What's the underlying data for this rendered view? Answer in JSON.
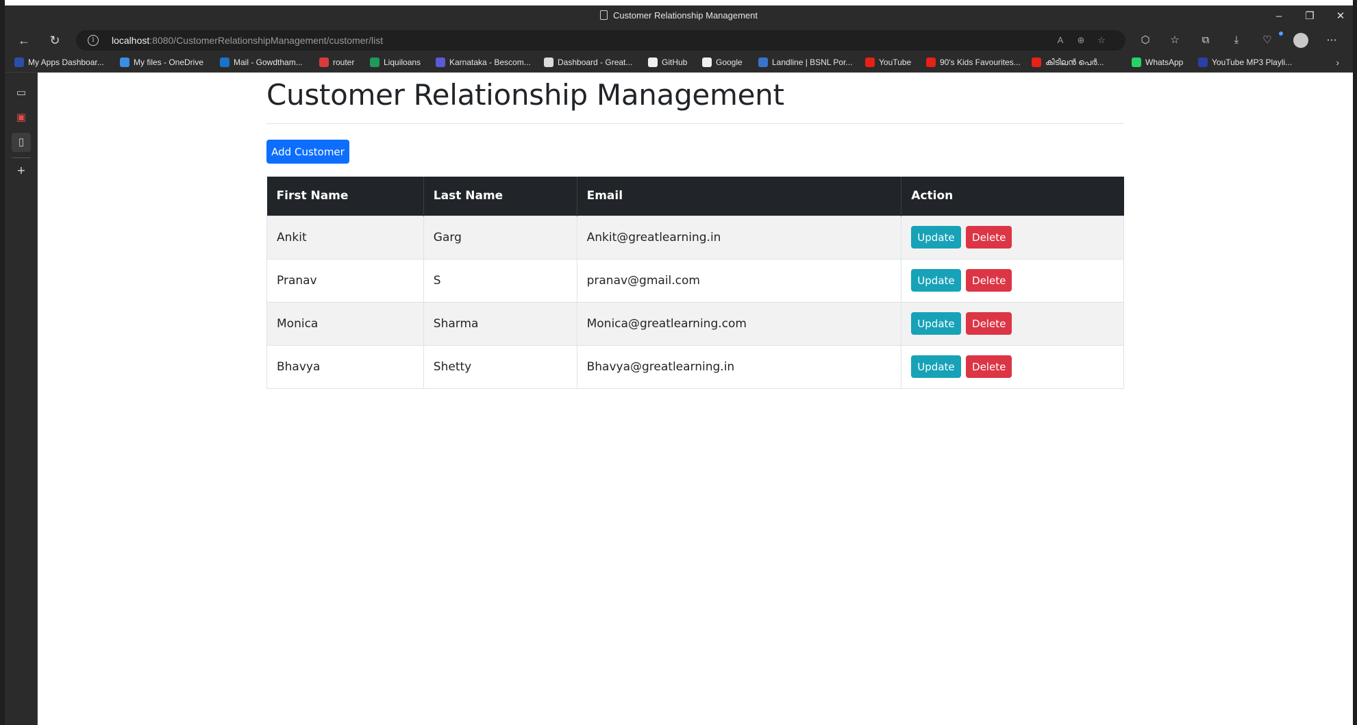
{
  "window": {
    "title": "Customer Relationship Management",
    "minimize": "–",
    "restore": "❐",
    "close": "✕"
  },
  "toolbar": {
    "back": "←",
    "refresh": "↻",
    "url_host": "localhost",
    "url_rest": ":8080/CustomerRelationshipManagement/customer/list",
    "more": "⋯"
  },
  "bookmarks": [
    {
      "label": "My Apps Dashboar...",
      "color": "#2b4ea8"
    },
    {
      "label": "My files - OneDrive",
      "color": "#3a8ee6"
    },
    {
      "label": "Mail - Gowdtham...",
      "color": "#1a73c8"
    },
    {
      "label": "router",
      "color": "#d93b3b"
    },
    {
      "label": "Liquiloans",
      "color": "#1e9a5a"
    },
    {
      "label": "Karnataka - Bescom...",
      "color": "#5a5ad6"
    },
    {
      "label": "Dashboard - Great...",
      "color": "#dcdcdc"
    },
    {
      "label": "GitHub",
      "color": "#f0f0f0"
    },
    {
      "label": "Google",
      "color": "#f0f0f0"
    },
    {
      "label": "Landline | BSNL Por...",
      "color": "#3a74c9"
    },
    {
      "label": "YouTube",
      "color": "#e62117"
    },
    {
      "label": "90's Kids Favourites...",
      "color": "#e62117"
    },
    {
      "label": "കിടിലൻ പെർ...",
      "color": "#e62117"
    },
    {
      "label": "WhatsApp",
      "color": "#25d366"
    },
    {
      "label": "YouTube MP3 Playli...",
      "color": "#2a3fa8"
    }
  ],
  "page": {
    "title": "Customer Relationship Management",
    "add_button": "Add Customer"
  },
  "table": {
    "headers": [
      "First Name",
      "Last Name",
      "Email",
      "Action"
    ],
    "rows": [
      {
        "first": "Ankit",
        "last": "Garg",
        "email": "Ankit@greatlearning.in"
      },
      {
        "first": "Pranav",
        "last": "S",
        "email": "pranav@gmail.com"
      },
      {
        "first": "Monica",
        "last": "Sharma",
        "email": "Monica@greatlearning.com"
      },
      {
        "first": "Bhavya",
        "last": "Shetty",
        "email": "Bhavya@greatlearning.in"
      }
    ],
    "update_label": "Update",
    "delete_label": "Delete"
  },
  "colors": {
    "primary": "#0d6efd",
    "info": "#17a2b8",
    "danger": "#dc3545",
    "table_header": "#212529"
  },
  "icons": [
    "page-icon",
    "back-icon",
    "refresh-icon",
    "info-icon",
    "read-aloud-icon",
    "zoom-icon",
    "favorite-add-icon",
    "extensions-icon",
    "favorites-icon",
    "collections-icon",
    "downloads-icon",
    "browser-essentials-icon",
    "profile-icon",
    "more-icon",
    "chevron-right-icon",
    "tabs-icon",
    "pdf-icon",
    "document-icon",
    "plus-icon"
  ]
}
